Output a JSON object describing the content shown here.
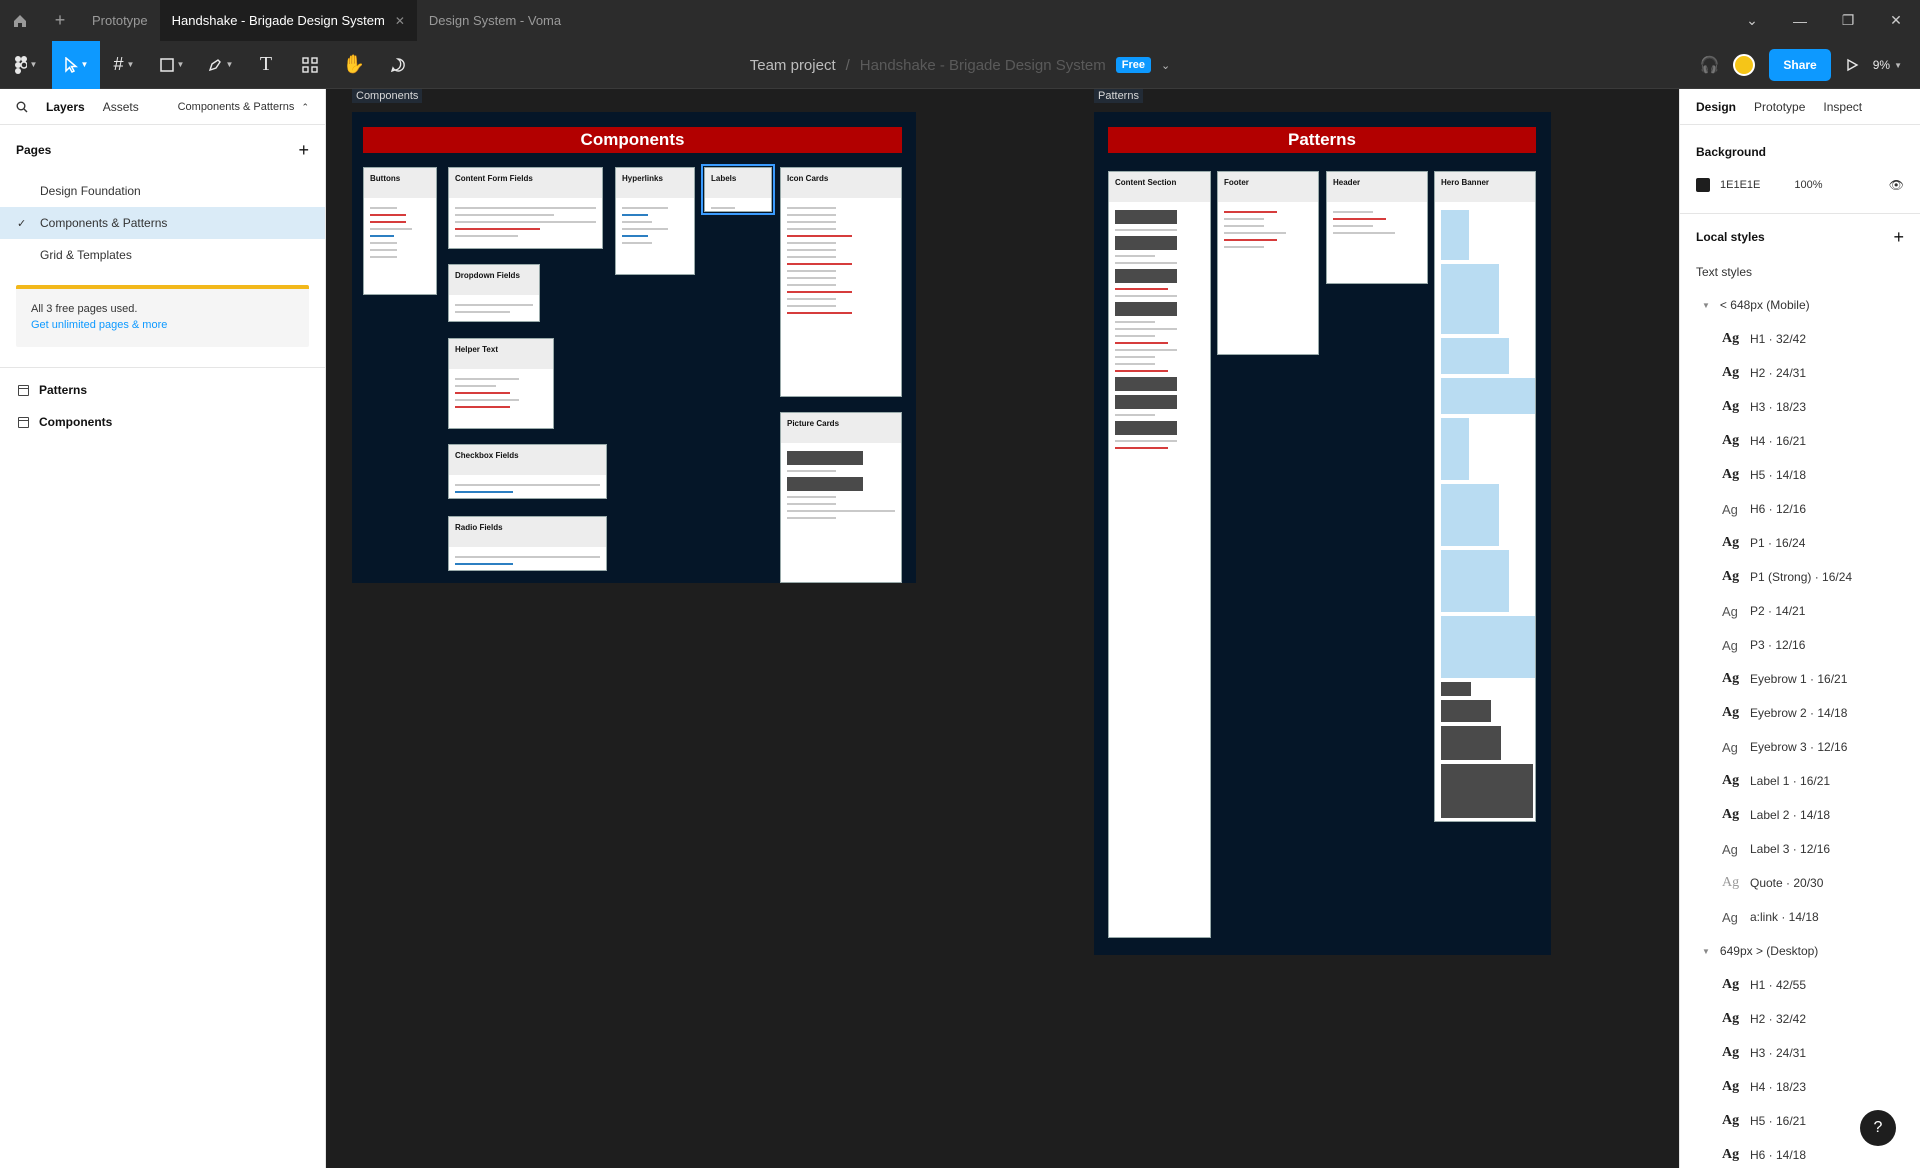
{
  "titlebar": {
    "tabs": [
      {
        "label": "Prototype",
        "active": false
      },
      {
        "label": "Handshake - Brigade Design System",
        "active": true
      },
      {
        "label": "Design System - Voma",
        "active": false
      }
    ],
    "new_tab_icon": "plus-icon",
    "home_icon": "home-icon"
  },
  "toolbar": {
    "project": "Team project",
    "separator": "/",
    "file_name": "Handshake - Brigade Design System",
    "plan_badge": "Free",
    "share_label": "Share",
    "zoom": "9%"
  },
  "left_panel": {
    "tabs": {
      "layers": "Layers",
      "assets": "Assets",
      "current_page": "Components & Patterns"
    },
    "pages_title": "Pages",
    "pages": [
      {
        "label": "Design Foundation",
        "selected": false
      },
      {
        "label": "Components & Patterns",
        "selected": true
      },
      {
        "label": "Grid & Templates",
        "selected": false
      }
    ],
    "notice_text": "All 3 free pages used.",
    "notice_link": "Get unlimited pages & more",
    "layers": [
      {
        "label": "Patterns"
      },
      {
        "label": "Components"
      }
    ]
  },
  "right_panel": {
    "tabs": {
      "design": "Design",
      "prototype": "Prototype",
      "inspect": "Inspect"
    },
    "background_title": "Background",
    "background_hex": "1E1E1E",
    "background_opacity": "100%",
    "local_styles_title": "Local styles",
    "text_styles_title": "Text styles",
    "groups": [
      {
        "label": "< 648px (Mobile)",
        "styles": [
          "H1 · 32/42",
          "H2 · 24/31",
          "H3 · 18/23",
          "H4 · 16/21",
          "H5 · 14/18",
          "H6 · 12/16",
          "P1 · 16/24",
          "P1 (Strong) · 16/24",
          "P2 · 14/21",
          "P3 · 12/16",
          "Eyebrow 1 · 16/21",
          "Eyebrow 2 · 14/18",
          "Eyebrow 3 · 12/16",
          "Label 1 · 16/21",
          "Label 2 · 14/18",
          "Label 3 · 12/16",
          "Quote · 20/30",
          "a:link · 14/18"
        ]
      },
      {
        "label": "649px > (Desktop)",
        "styles": [
          "H1 · 42/55",
          "H2 · 32/42",
          "H3 · 24/31",
          "H4 · 18/23",
          "H5 · 16/21",
          "H6 · 14/18"
        ]
      }
    ],
    "style_glyph": "Ag"
  },
  "canvas": {
    "components_frame_label": "Components",
    "patterns_frame_label": "Patterns",
    "components_banner": "Components",
    "patterns_banner": "Patterns",
    "component_cards": {
      "buttons": "Buttons",
      "content_form_fields": "Content Form Fields",
      "hyperlinks": "Hyperlinks",
      "labels": "Labels",
      "icon_cards": "Icon Cards",
      "dropdown_fields": "Dropdown Fields",
      "helper_text": "Helper Text",
      "checkbox_fields": "Checkbox Fields",
      "radio_fields": "Radio Fields",
      "picture_cards": "Picture Cards"
    },
    "pattern_cards": {
      "content_section": "Content Section",
      "footer": "Footer",
      "header": "Header",
      "hero_banner": "Hero Banner"
    }
  },
  "colors": {
    "accent": "#0d99ff",
    "banner_red": "#b20000",
    "board_navy": "#051628",
    "canvas_bg": "#1e1e1e"
  }
}
